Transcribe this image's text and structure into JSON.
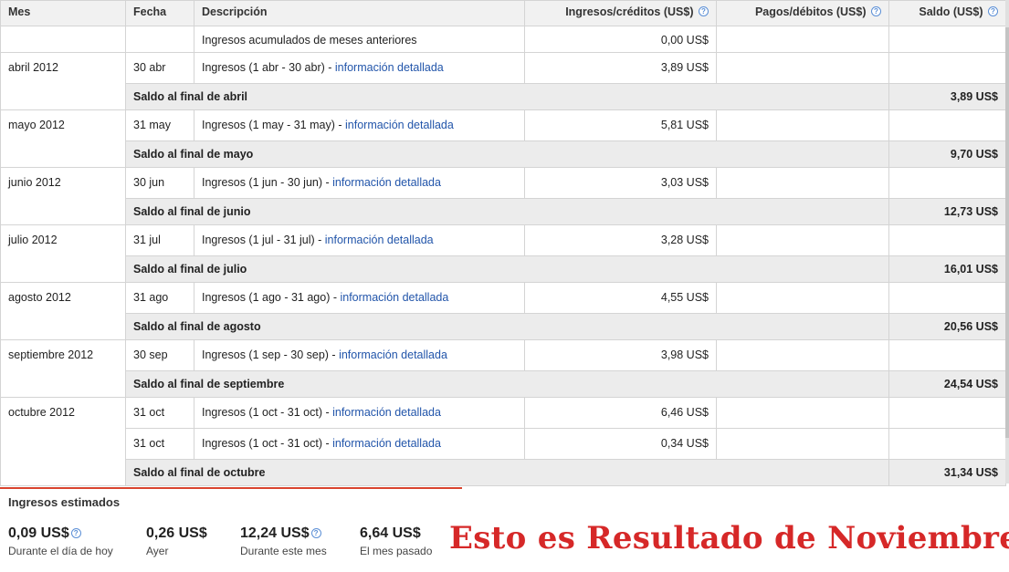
{
  "table": {
    "headers": {
      "mes": "Mes",
      "fecha": "Fecha",
      "descripcion": "Descripción",
      "ingresos": "Ingresos/créditos (US$)",
      "pagos": "Pagos/débitos (US$)",
      "saldo": "Saldo (US$)"
    },
    "accumulated": {
      "descripcion": "Ingresos acumulados de meses anteriores",
      "ingresos": "0,00 US$"
    },
    "link_text": "información detallada",
    "months": [
      {
        "mes": "abril 2012",
        "entries": [
          {
            "fecha": "30 abr",
            "desc": "Ingresos (1 abr - 30 abr) - ",
            "ingresos": "3,89 US$"
          }
        ],
        "saldo_label": "Saldo al final de abril",
        "saldo": "3,89 US$"
      },
      {
        "mes": "mayo 2012",
        "entries": [
          {
            "fecha": "31 may",
            "desc": "Ingresos (1 may - 31 may) - ",
            "ingresos": "5,81 US$"
          }
        ],
        "saldo_label": "Saldo al final de mayo",
        "saldo": "9,70 US$"
      },
      {
        "mes": "junio 2012",
        "entries": [
          {
            "fecha": "30 jun",
            "desc": "Ingresos (1 jun - 30 jun) - ",
            "ingresos": "3,03 US$"
          }
        ],
        "saldo_label": "Saldo al final de junio",
        "saldo": "12,73 US$"
      },
      {
        "mes": "julio 2012",
        "entries": [
          {
            "fecha": "31 jul",
            "desc": "Ingresos (1 jul - 31 jul) - ",
            "ingresos": "3,28 US$"
          }
        ],
        "saldo_label": "Saldo al final de julio",
        "saldo": "16,01 US$"
      },
      {
        "mes": "agosto 2012",
        "entries": [
          {
            "fecha": "31 ago",
            "desc": "Ingresos (1 ago - 31 ago) - ",
            "ingresos": "4,55 US$"
          }
        ],
        "saldo_label": "Saldo al final de agosto",
        "saldo": "20,56 US$"
      },
      {
        "mes": "septiembre 2012",
        "entries": [
          {
            "fecha": "30 sep",
            "desc": "Ingresos (1 sep - 30 sep) - ",
            "ingresos": "3,98 US$"
          }
        ],
        "saldo_label": "Saldo al final de septiembre",
        "saldo": "24,54 US$"
      },
      {
        "mes": "octubre 2012",
        "entries": [
          {
            "fecha": "31 oct",
            "desc": "Ingresos (1 oct - 31 oct) - ",
            "ingresos": "6,46 US$"
          },
          {
            "fecha": "31 oct",
            "desc": "Ingresos (1 oct - 31 oct) - ",
            "ingresos": "0,34 US$"
          }
        ],
        "saldo_label": "Saldo al final de octubre",
        "saldo": "31,34 US$"
      }
    ]
  },
  "estimated": {
    "title": "Ingresos estimados",
    "metrics": [
      {
        "value": "0,09 US$",
        "label": "Durante el día de hoy",
        "help": true
      },
      {
        "value": "0,26 US$",
        "label": "Ayer",
        "help": false
      },
      {
        "value": "12,24 US$",
        "label": "Durante este mes",
        "help": true
      },
      {
        "value": "6,64 US$",
        "label": "El mes pasado",
        "help": false
      }
    ]
  },
  "overlay_text": "Esto es Resultado de Noviembre",
  "help_glyph": "?",
  "colors": {
    "link": "#2255aa",
    "overlay": "#d62828",
    "divider": "#d9442f",
    "saldo_row_bg": "#ececec"
  }
}
